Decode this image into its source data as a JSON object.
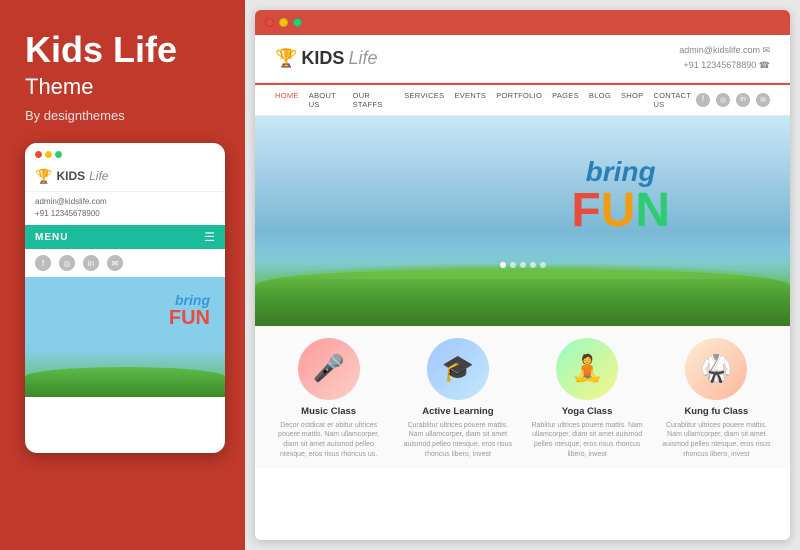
{
  "leftPanel": {
    "title": "Kids Life",
    "subtitle": "Theme",
    "author": "By designthemes"
  },
  "mobile": {
    "dots": [
      "red",
      "yellow",
      "green"
    ],
    "logo": {
      "trophy": "🏆",
      "kids": "KIDS",
      "life": "Life"
    },
    "contact": {
      "email": "admin@kidslife.com",
      "phone": "+91 12345678900"
    },
    "menu": {
      "label": "MENU"
    },
    "hero": {
      "bring": "bring",
      "fun": "FUN"
    }
  },
  "browser": {
    "dots": [
      "d1",
      "d2",
      "d3"
    ],
    "header": {
      "trophy": "🏆",
      "kids": "KIDS",
      "life": "Life",
      "email": "admin@kidslife.com ✉",
      "phone": "+91 12345678890 ☎"
    },
    "nav": {
      "links": [
        "HOME",
        "ABOUT US",
        "OUR STAFFS",
        "SERVICES",
        "EVENTS",
        "PORTFOLIO",
        "PAGES",
        "BLOG",
        "SHOP",
        "CONTACT US"
      ]
    },
    "hero": {
      "bring": "bring",
      "fun_f": "F",
      "fun_u": "U",
      "fun_n": "N",
      "dots": [
        1,
        2,
        3,
        4,
        5
      ]
    },
    "classes": {
      "items": [
        {
          "name": "Music Class",
          "emoji": "🎤",
          "desc": "Decor ostdicar er abitur ultrices pouere mattis. Nam ullamcorper, diam sit amet auismod pelle ntesque, eros risus rhoncus us.",
          "bgClass": "music"
        },
        {
          "name": "Active Learning",
          "emoji": "🎓",
          "desc": "Curablitur ultrices pouere mattis. Nam ullamcorper, diam sit amet auismod pelleo ntesque, eros risus rhoncus libero, invest",
          "bgClass": "learning"
        },
        {
          "name": "Yoga Class",
          "emoji": "🧘",
          "desc": "Rablitur ultrices pouere mattis. Nam ullamcorper, diam sit amet auismod pelleo ntesque, eros risus rhoncus libero, invest",
          "bgClass": "yoga"
        },
        {
          "name": "Kung fu Class",
          "emoji": "🥋",
          "desc": "Curablitur ultrices pouere mattis. Nam ullamcorper, diam sit amet auismod pelleo ntesque, eros risus rhoncus libero, invest",
          "bgClass": "kungfu"
        }
      ]
    }
  }
}
